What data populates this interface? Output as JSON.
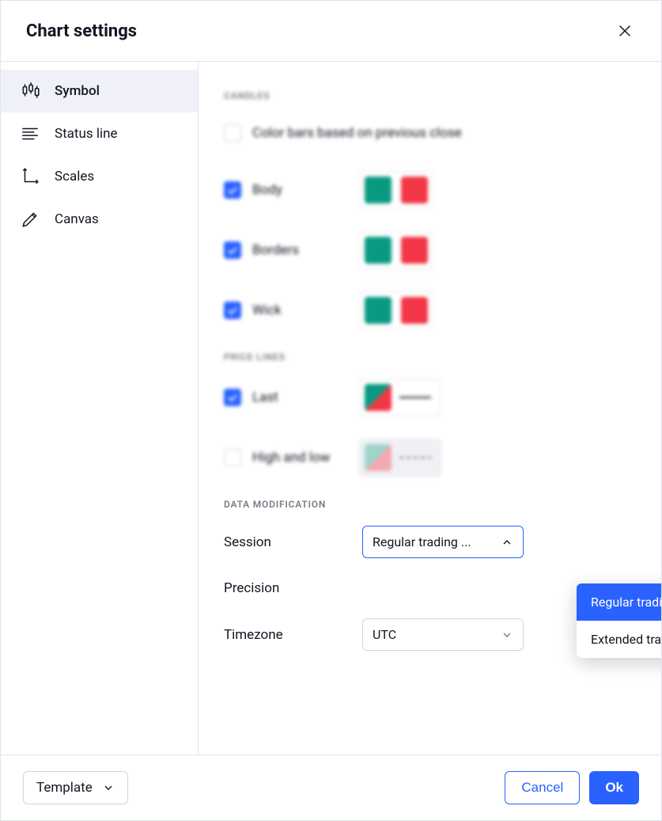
{
  "header": {
    "title": "Chart settings"
  },
  "sidebar": {
    "items": [
      {
        "label": "Symbol",
        "active": true
      },
      {
        "label": "Status line",
        "active": false
      },
      {
        "label": "Scales",
        "active": false
      },
      {
        "label": "Canvas",
        "active": false
      }
    ]
  },
  "sections": {
    "candles": {
      "title": "Candles",
      "color_bars_label": "Color bars based on previous close",
      "body_label": "Body",
      "borders_label": "Borders",
      "wick_label": "Wick",
      "up_color": "#089981",
      "down_color": "#f23645"
    },
    "price_lines": {
      "title": "Price Lines",
      "last_label": "Last",
      "high_low_label": "High and low"
    },
    "data_modification": {
      "title": "DATA MODIFICATION",
      "session_label": "Session",
      "session_value": "Regular trading ...",
      "session_options": [
        "Regular trading hours",
        "Extended trading hours"
      ],
      "precision_label": "Precision",
      "timezone_label": "Timezone",
      "timezone_value": "UTC"
    }
  },
  "footer": {
    "template_label": "Template",
    "cancel_label": "Cancel",
    "ok_label": "Ok"
  }
}
